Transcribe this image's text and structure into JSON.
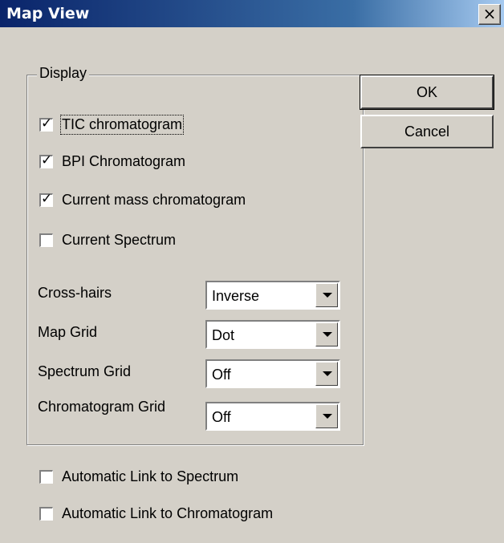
{
  "window": {
    "title": "Map View",
    "close_glyph": "×"
  },
  "display_group": {
    "label": "Display",
    "checkboxes": [
      {
        "label": "TIC chromatogram",
        "checked": true
      },
      {
        "label": "BPI Chromatogram",
        "checked": true
      },
      {
        "label": "Current mass chromatogram",
        "checked": true
      },
      {
        "label": "Current Spectrum",
        "checked": false
      }
    ],
    "combos": [
      {
        "label": "Cross-hairs",
        "value": "Inverse"
      },
      {
        "label": "Map Grid",
        "value": "Dot"
      },
      {
        "label": "Spectrum Grid",
        "value": "Off"
      },
      {
        "label": "Chromatogram Grid",
        "value": "Off"
      }
    ]
  },
  "buttons": {
    "ok": "OK",
    "cancel": "Cancel"
  },
  "links": [
    {
      "label": "Automatic Link to Spectrum",
      "checked": false
    },
    {
      "label": "Automatic Link to Chromatogram",
      "checked": false
    }
  ],
  "icons": {
    "checkmark": "check-icon",
    "dropdown": "chevron-down-icon",
    "close": "close-icon"
  }
}
